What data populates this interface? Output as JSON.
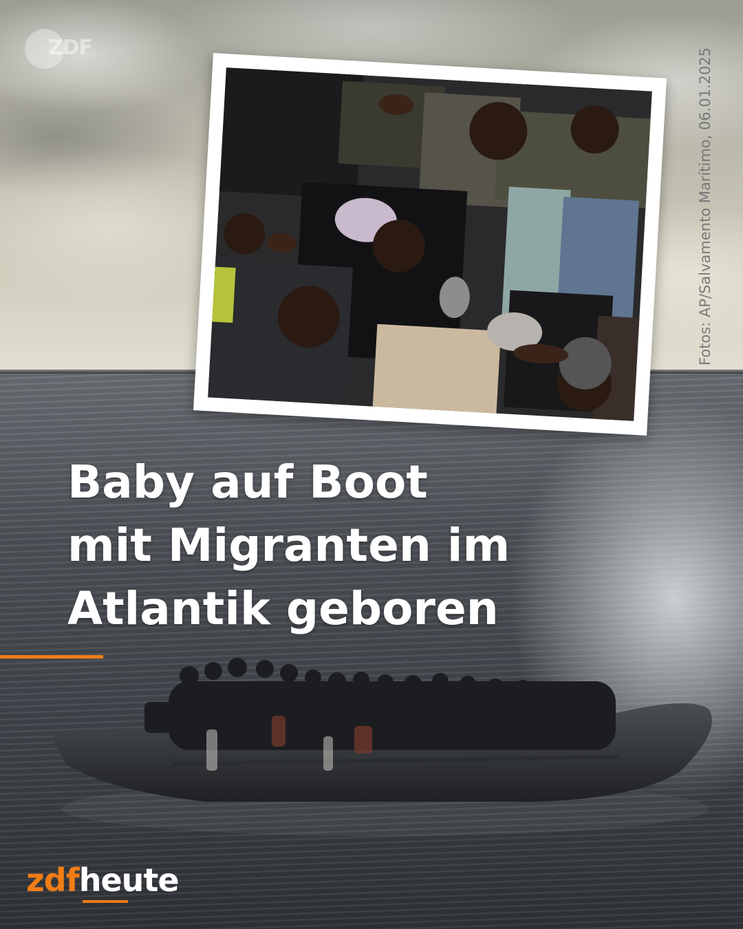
{
  "watermark": {
    "text": "ZDF"
  },
  "credit": {
    "text": "Fotos: AP/Salvamento Marítimo, 06.01.2025"
  },
  "headline": {
    "lines": [
      "Baby auf Boot",
      "mit Migranten im",
      "Atlantik geboren"
    ]
  },
  "logo": {
    "part1": "zdf",
    "part2": "heute"
  },
  "colors": {
    "accent": "#f07d14",
    "text": "#ffffff",
    "frame": "#ffffff"
  },
  "images": {
    "inset_photo": "people crowded in a boat around a newborn baby",
    "background": "inflatable migrant boat on the Atlantic under a cloudy sky"
  }
}
